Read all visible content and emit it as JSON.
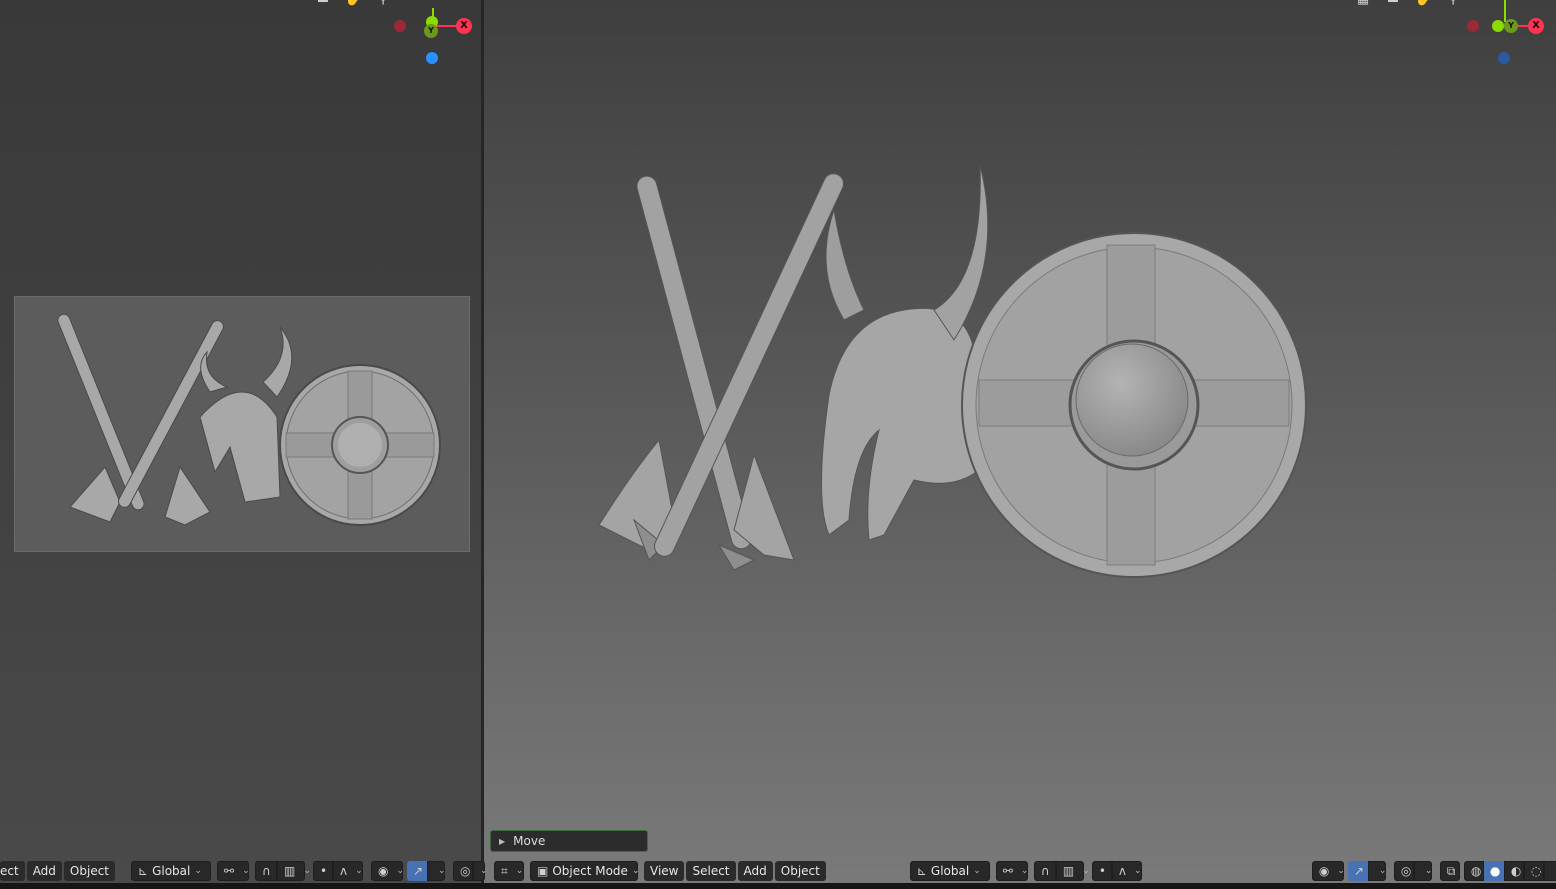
{
  "left_toolbar": {
    "menu": [
      "ect",
      "Add",
      "Object"
    ],
    "orientation": "Global"
  },
  "right_toolbar": {
    "mode": "Object Mode",
    "menu": [
      "View",
      "Select",
      "Add",
      "Object"
    ],
    "orientation": "Global"
  },
  "operator_panel": {
    "label": "Move"
  },
  "gizmo": {
    "x_label": "X",
    "y_label": "Y",
    "colors": {
      "x": "#ff3352",
      "y": "#8bdc00",
      "z": "#2890ff"
    }
  },
  "icons": {
    "header_left": [
      "camera-icon",
      "hand-icon",
      "zoom-icon"
    ],
    "header_right": [
      "grid-icon",
      "camera-icon",
      "hand-icon",
      "zoom-icon"
    ],
    "shading": [
      "wireframe-icon",
      "solid-icon",
      "material-icon",
      "rendered-icon"
    ]
  }
}
